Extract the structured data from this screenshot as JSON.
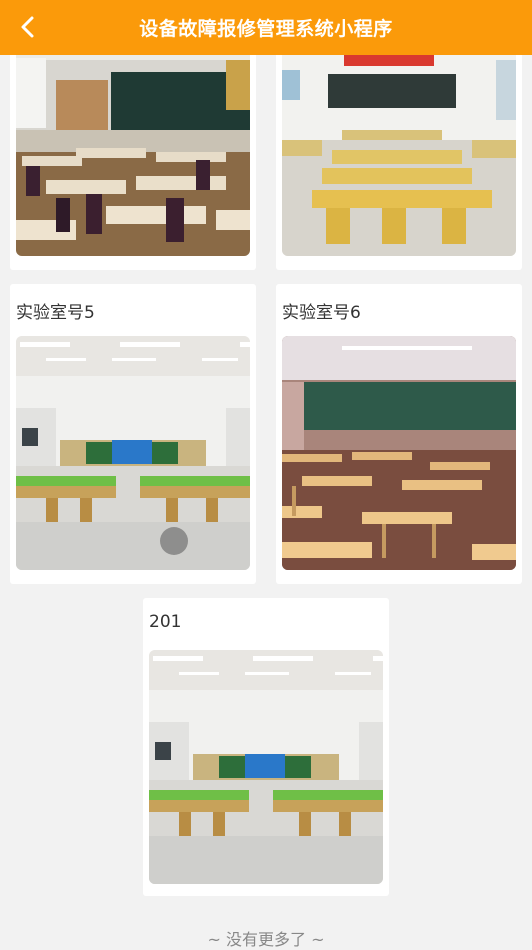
{
  "header": {
    "title": "设备故障报修管理系统小程序",
    "back_icon": "chevron-left-icon",
    "background_color": "#fb9a0a"
  },
  "labs": [
    {
      "name": "",
      "image": "classroom-dark-desks-photo"
    },
    {
      "name": "",
      "image": "classroom-yellow-desks-photo"
    },
    {
      "name": "实验室号5",
      "image": "lab-green-benches-photo"
    },
    {
      "name": "实验室号6",
      "image": "classroom-wooden-desks-photo"
    },
    {
      "name": "201",
      "image": "lab-green-benches-photo"
    }
  ],
  "footer": {
    "end_text": "~ 没有更多了 ~"
  }
}
